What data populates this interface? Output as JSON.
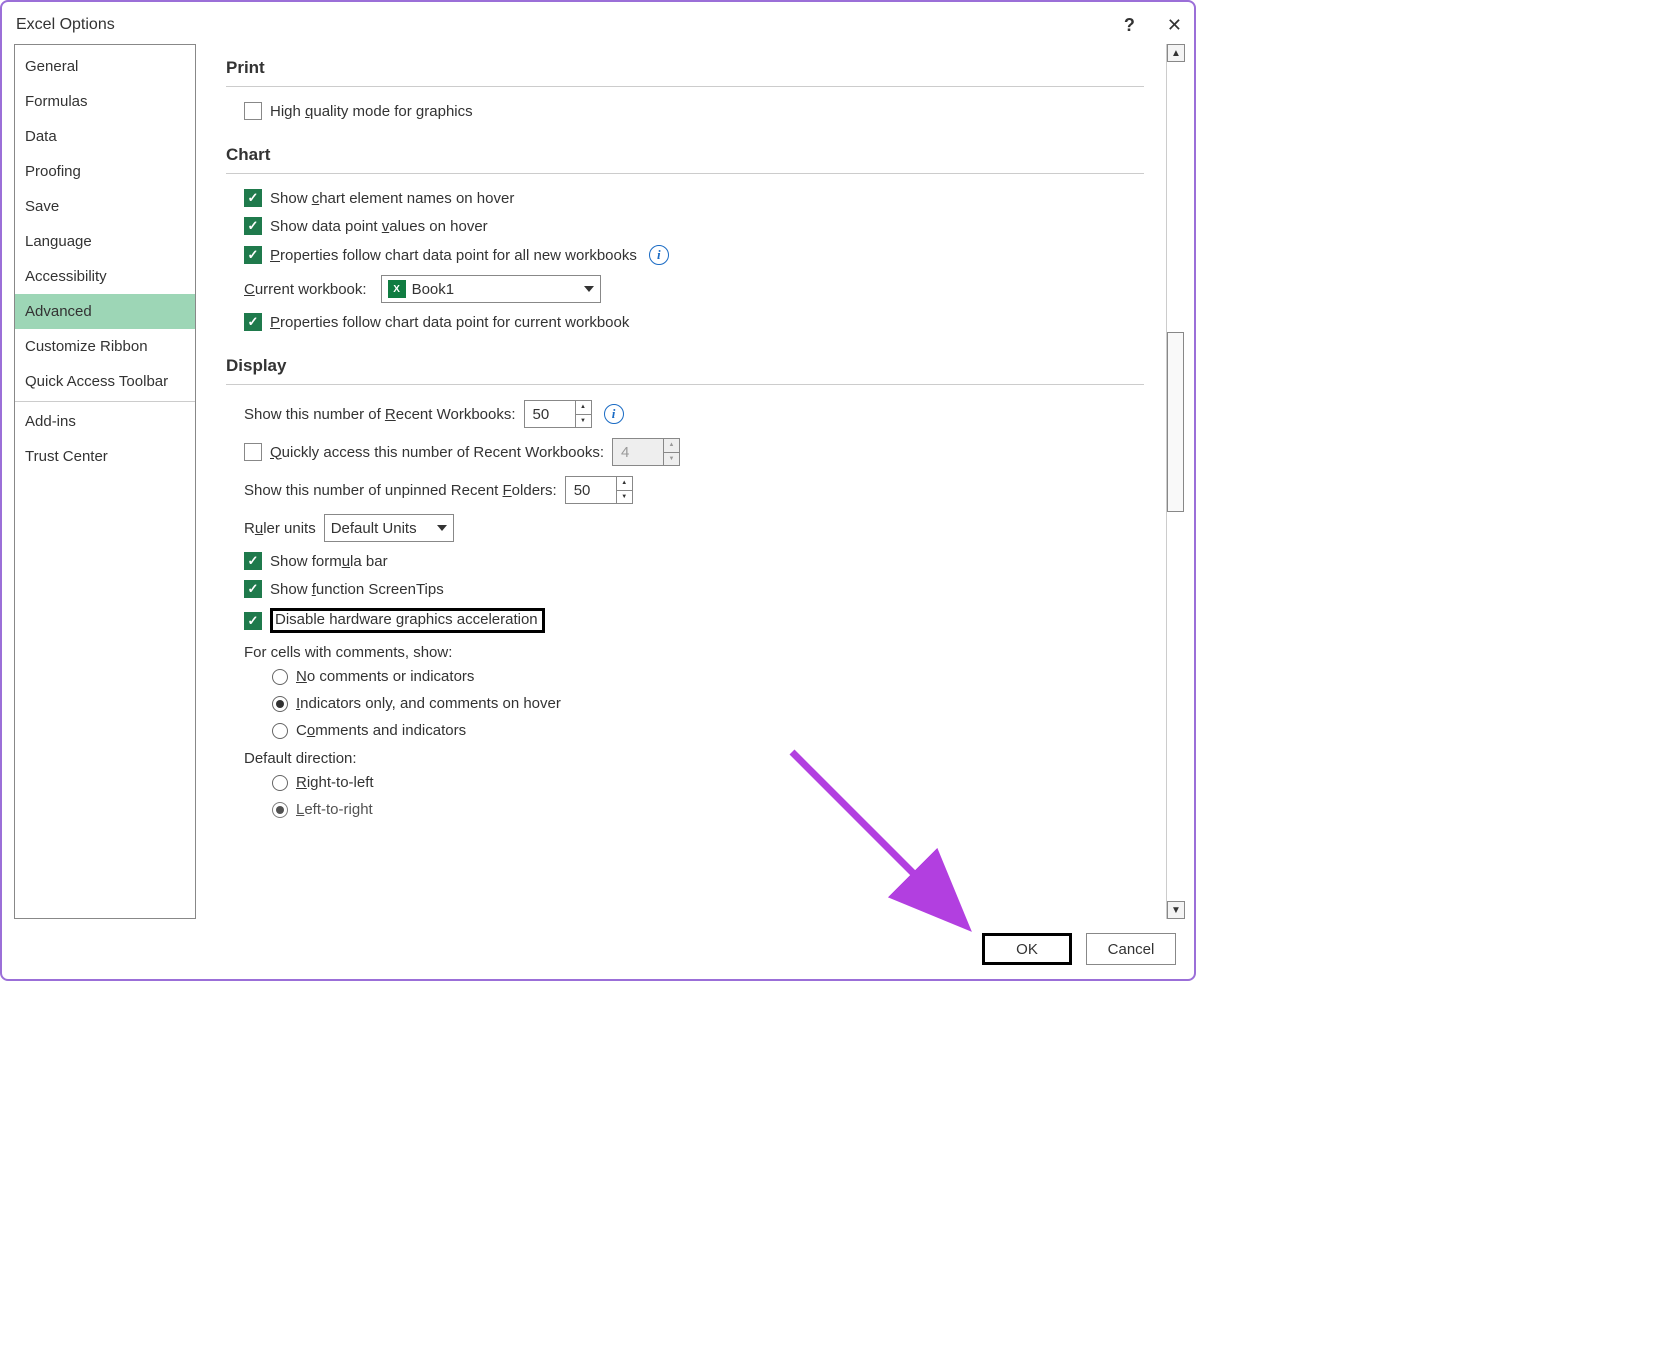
{
  "title": "Excel Options",
  "sidebar": {
    "items": [
      {
        "label": "General"
      },
      {
        "label": "Formulas"
      },
      {
        "label": "Data"
      },
      {
        "label": "Proofing"
      },
      {
        "label": "Save"
      },
      {
        "label": "Language"
      },
      {
        "label": "Accessibility"
      },
      {
        "label": "Advanced"
      },
      {
        "label": "Customize Ribbon"
      },
      {
        "label": "Quick Access Toolbar"
      },
      {
        "label": "Add-ins"
      },
      {
        "label": "Trust Center"
      }
    ]
  },
  "sections": {
    "print": {
      "title": "Print",
      "hq": "High quality mode for graphics"
    },
    "chart": {
      "title": "Chart",
      "elem_names": "Show chart element names on hover",
      "data_values": "Show data point values on hover",
      "props_all": "Properties follow chart data point for all new workbooks",
      "current_label": "Current workbook:",
      "current_value": "Book1",
      "props_current": "Properties follow chart data point for current workbook"
    },
    "display": {
      "title": "Display",
      "recent_wb_label": "Show this number of Recent Workbooks:",
      "recent_wb_val": "50",
      "quick_access": "Quickly access this number of Recent Workbooks:",
      "quick_access_val": "4",
      "recent_folders_label": "Show this number of unpinned Recent Folders:",
      "recent_folders_val": "50",
      "ruler_label": "Ruler units",
      "ruler_value": "Default Units",
      "formula_bar": "Show formula bar",
      "screentips": "Show function ScreenTips",
      "disable_hw": "Disable hardware graphics acceleration",
      "comments_label": "For cells with comments, show:",
      "comments": {
        "none": "No comments or indicators",
        "indicators": "Indicators only, and comments on hover",
        "both": "Comments and indicators"
      },
      "direction_label": "Default direction:",
      "direction": {
        "rtl": "Right-to-left",
        "ltr": "Left-to-right"
      }
    }
  },
  "buttons": {
    "ok": "OK",
    "cancel": "Cancel"
  }
}
